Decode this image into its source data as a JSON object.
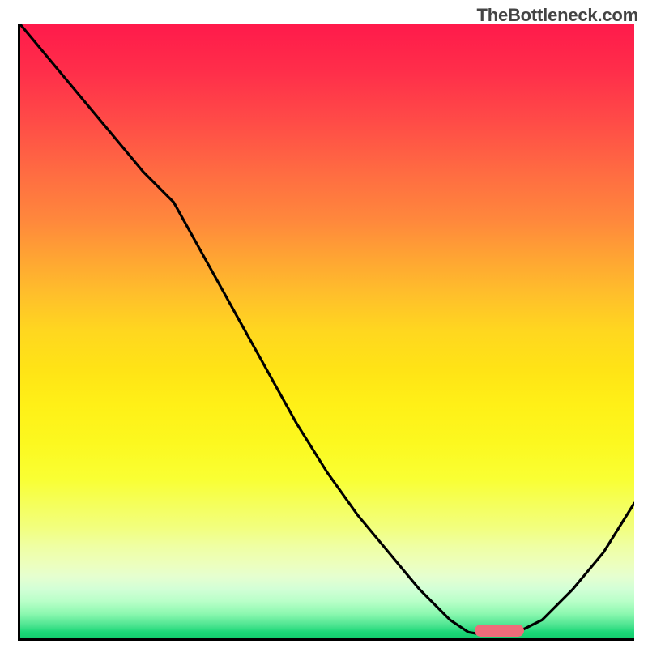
{
  "watermark": "TheBottleneck.com",
  "chart_data": {
    "type": "line",
    "title": "",
    "xlabel": "",
    "ylabel": "",
    "xlim": [
      0,
      100
    ],
    "ylim": [
      0,
      100
    ],
    "grid": false,
    "series": [
      {
        "name": "curve",
        "x": [
          0,
          5,
          10,
          15,
          20,
          25,
          30,
          35,
          40,
          45,
          50,
          55,
          60,
          65,
          70,
          73,
          76,
          80,
          85,
          90,
          95,
          100
        ],
        "y": [
          100,
          94,
          88,
          82,
          76,
          71,
          62,
          53,
          44,
          35,
          27,
          20,
          14,
          8,
          3,
          1,
          0.5,
          0.5,
          3,
          8,
          14,
          22
        ]
      }
    ],
    "marker": {
      "x_center": 78,
      "y": 1.3,
      "width_pct": 8,
      "color": "#ee6c7a",
      "shape": "pill"
    },
    "background_gradient": {
      "top": "#ff1a4b",
      "mid": "#ffe316",
      "bottom": "#14ce6e"
    }
  }
}
